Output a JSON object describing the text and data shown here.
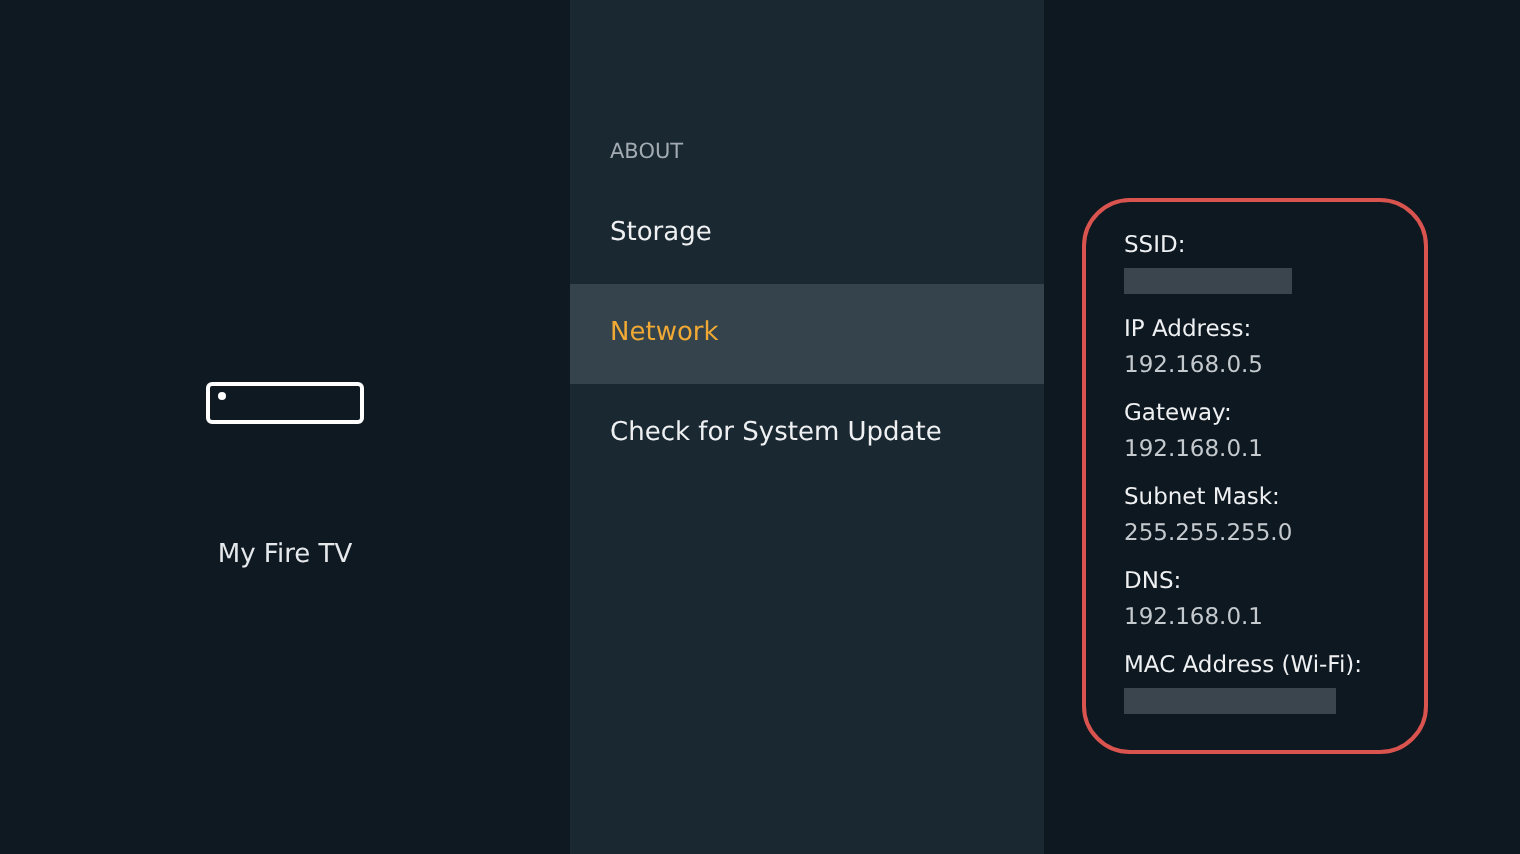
{
  "device": {
    "name": "My Fire TV"
  },
  "menu": {
    "heading": "ABOUT",
    "items": [
      {
        "label": "Storage",
        "selected": false
      },
      {
        "label": "Network",
        "selected": true
      },
      {
        "label": "Check for System Update",
        "selected": false
      }
    ]
  },
  "details": {
    "highlighted": true,
    "fields": [
      {
        "label": "SSID:",
        "redacted": true
      },
      {
        "label": "IP Address:",
        "value": "192.168.0.5",
        "redacted": false
      },
      {
        "label": "Gateway:",
        "value": "192.168.0.1",
        "redacted": false
      },
      {
        "label": "Subnet Mask:",
        "value": "255.255.255.0",
        "redacted": false
      },
      {
        "label": "DNS:",
        "value": "192.168.0.1",
        "redacted": false
      },
      {
        "label": "MAC Address (Wi-Fi):",
        "redacted": true
      }
    ]
  }
}
